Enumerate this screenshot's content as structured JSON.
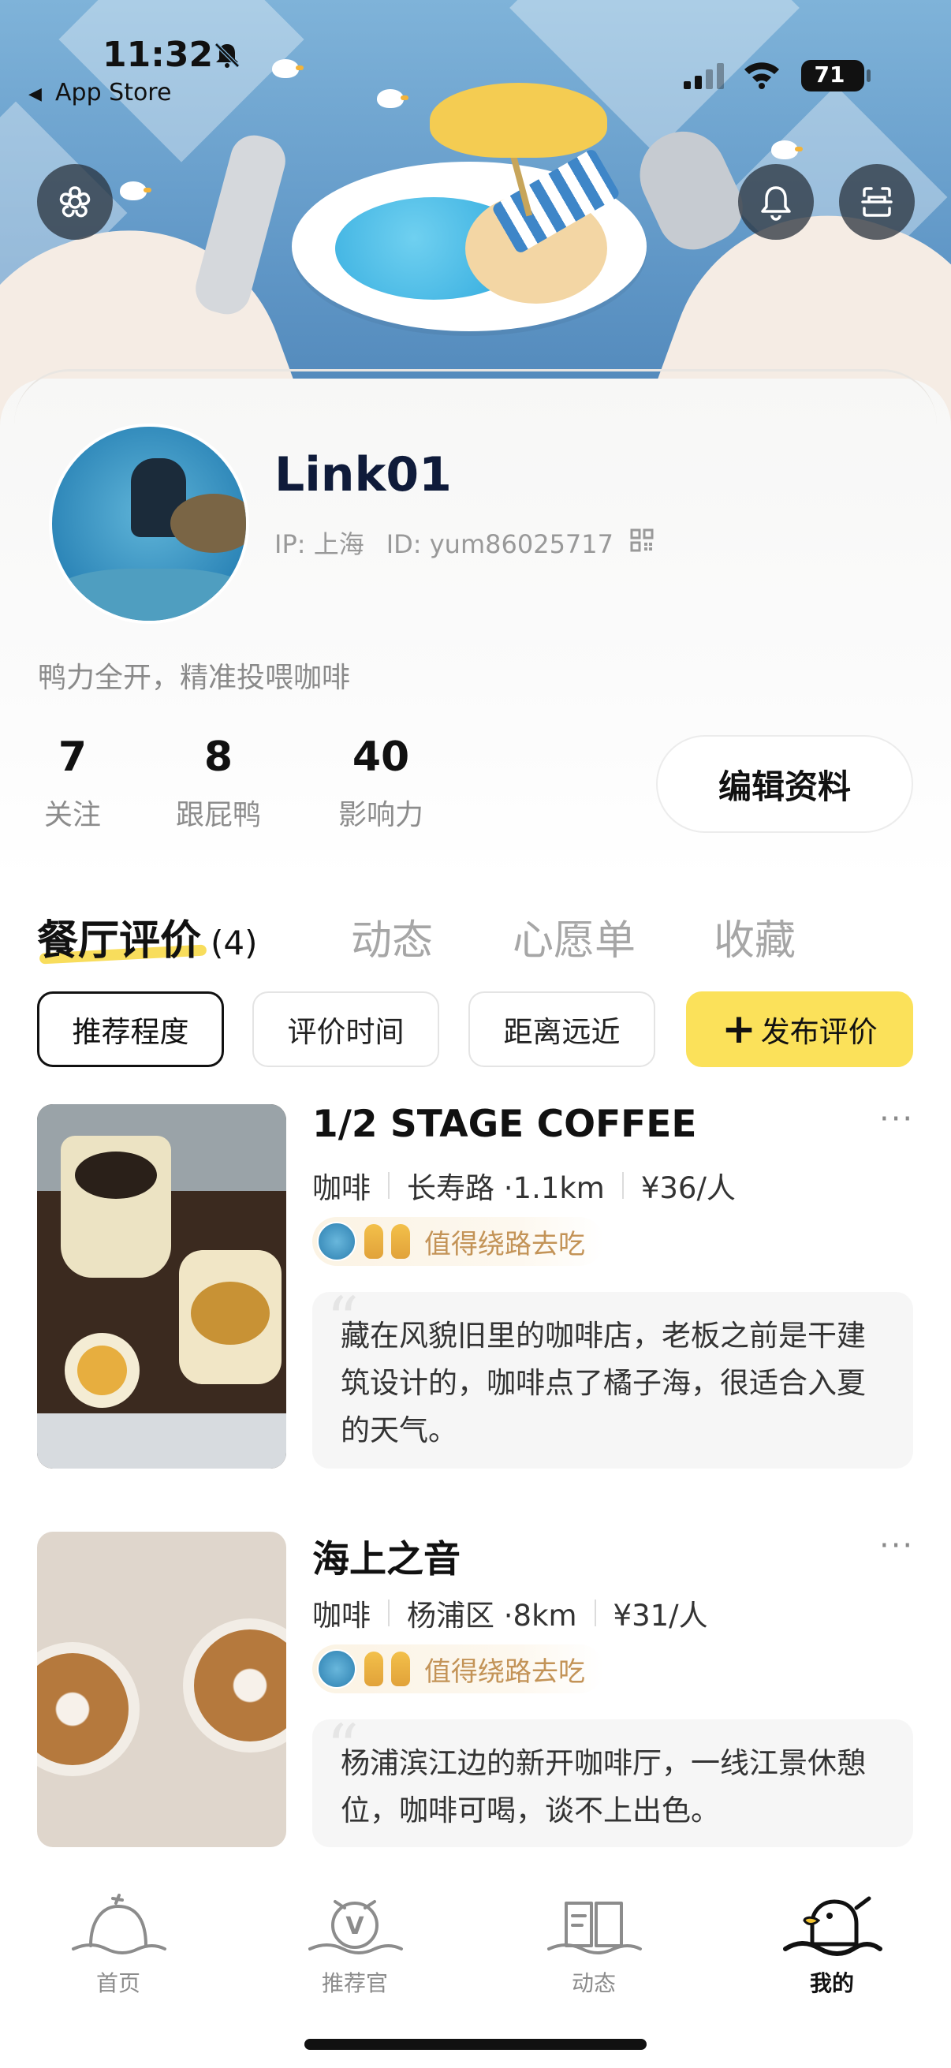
{
  "status_bar": {
    "time": "11:32",
    "back_label": "App Store",
    "battery": "71"
  },
  "profile": {
    "username": "Link01",
    "ip": "IP: 上海",
    "id": "ID: yum86025717",
    "bio": "鸭力全开，精准投喂咖啡",
    "stats": [
      {
        "value": "7",
        "label": "关注"
      },
      {
        "value": "8",
        "label": "跟屁鸭"
      },
      {
        "value": "40",
        "label": "影响力"
      }
    ],
    "edit_label": "编辑资料"
  },
  "tabs": [
    {
      "label": "餐厅评价",
      "count": "(4)",
      "active": true
    },
    {
      "label": "动态",
      "active": false
    },
    {
      "label": "心愿单",
      "active": false
    },
    {
      "label": "收藏",
      "active": false
    }
  ],
  "filters": [
    {
      "label": "推荐程度",
      "active": true
    },
    {
      "label": "评价时间",
      "active": false
    },
    {
      "label": "距离远近",
      "active": false
    }
  ],
  "publish_label": "发布评价",
  "reviews": [
    {
      "title": "1/2 STAGE COFFEE",
      "category": "咖啡",
      "location": "长寿路 ·1.1km",
      "price": "¥36/人",
      "badge": "值得绕路去吃",
      "comment": "藏在风貌旧里的咖啡店，老板之前是干建筑设计的，咖啡点了橘子海，很适合入夏的天气。"
    },
    {
      "title": "海上之音",
      "category": "咖啡",
      "location": "杨浦区 ·8km",
      "price": "¥31/人",
      "badge": "值得绕路去吃",
      "comment": "杨浦滨江边的新开咖啡厅，一线江景休憩位，咖啡可喝，谈不上出色。"
    }
  ],
  "more_label": "···",
  "bottom_nav": [
    {
      "label": "首页",
      "icon": "home-duck-icon",
      "active": false
    },
    {
      "label": "推荐官",
      "icon": "recommender-icon",
      "active": false
    },
    {
      "label": "动态",
      "icon": "feed-book-icon",
      "active": false
    },
    {
      "label": "我的",
      "icon": "profile-duck-icon",
      "active": true
    }
  ],
  "colors": {
    "accent": "#fbe15a",
    "badge_text": "#c39357"
  }
}
